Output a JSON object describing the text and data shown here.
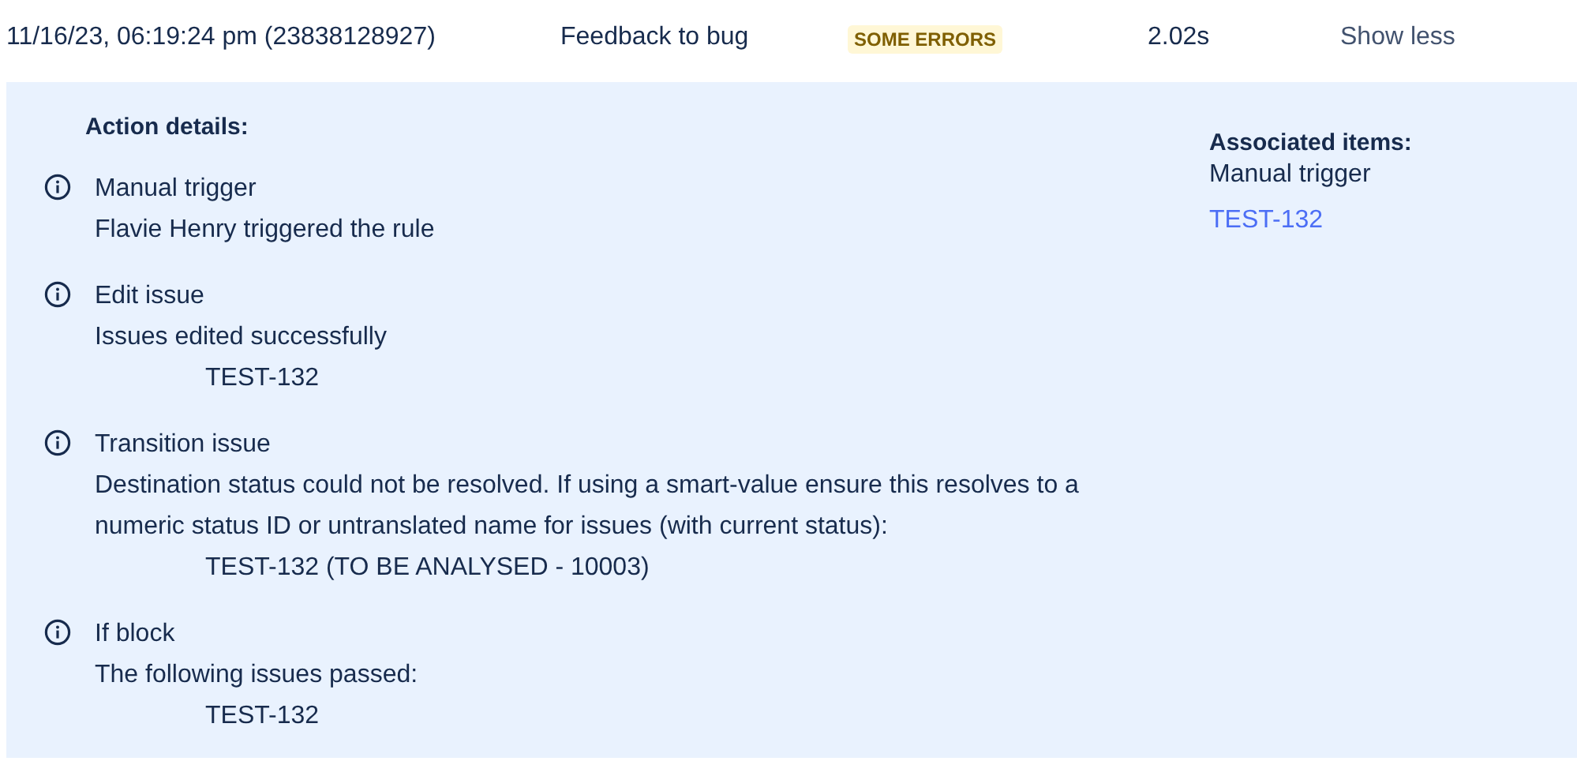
{
  "header": {
    "timestamp": "11/16/23, 06:19:24 pm (23838128927)",
    "rule": "Feedback to bug",
    "status": {
      "label": "SOME ERRORS",
      "kind": "warning"
    },
    "duration": "2.02s",
    "toggle": "Show less"
  },
  "details": {
    "heading": "Action details:",
    "actions": [
      {
        "title": "Manual trigger",
        "message": "Flavie Henry triggered the rule"
      },
      {
        "title": "Edit issue",
        "message": "Issues edited successfully",
        "issues": [
          "TEST-132"
        ]
      },
      {
        "title": "Transition issue",
        "message": "Destination status could not be resolved. If using a smart-value ensure this resolves to a numeric status ID or untranslated name for issues (with current status):",
        "issues": [
          "TEST-132 (TO BE ANALYSED - 10003)"
        ]
      },
      {
        "title": "If block",
        "message": "The following issues passed:",
        "issues": [
          "TEST-132"
        ]
      }
    ]
  },
  "associated": {
    "heading": "Associated items:",
    "trigger": "Manual trigger",
    "links": [
      "TEST-132"
    ]
  }
}
